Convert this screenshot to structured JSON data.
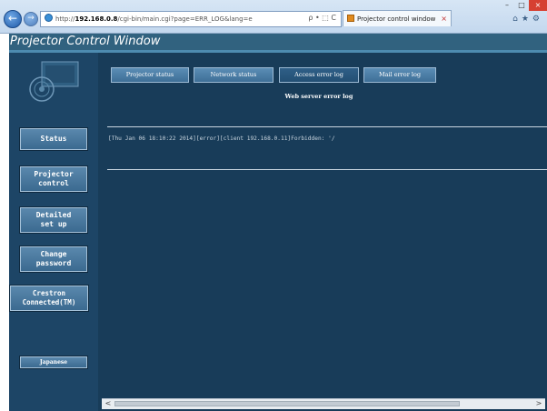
{
  "browser": {
    "address_prefix": "http://",
    "address_host": "192.168.0.8",
    "address_path": "/cgi-bin/main.cgi?page=ERR_LOG&lang=e",
    "address_tools": "ρ • ⬚ C",
    "tab_title": "Projector control window",
    "tab_close": "×",
    "minimize": "–",
    "maximize": "□",
    "close": "×",
    "back": "←",
    "forward": "→",
    "toolbar_icons": "⌂★⚙"
  },
  "page": {
    "window_title": "Projector Control Window"
  },
  "sidebar": {
    "buttons": [
      {
        "label": "Status"
      },
      {
        "label": "Projector\ncontrol"
      },
      {
        "label": "Detailed\nset up"
      },
      {
        "label": "Change\npassword"
      },
      {
        "label": "Crestron\nConnected(TM)"
      },
      {
        "label": "Japanese"
      }
    ]
  },
  "tabs": [
    {
      "label": "Projector status"
    },
    {
      "label": "Network status"
    },
    {
      "label": "Access error log",
      "selected": true
    },
    {
      "label": "Mail error log"
    }
  ],
  "main": {
    "section_title": "Web server error log",
    "log_lines": [
      "[Thu Jan 06 18:10:22 2014][error][client 192.168.0.11]Forbidden: '/"
    ]
  },
  "scrollbar": {
    "left_arrow": "<",
    "right_arrow": ">"
  },
  "colors": {
    "page_background": "#183c59",
    "title_bar": "#31627f",
    "button": "#4a7aa1",
    "close_button": "#d64032"
  }
}
